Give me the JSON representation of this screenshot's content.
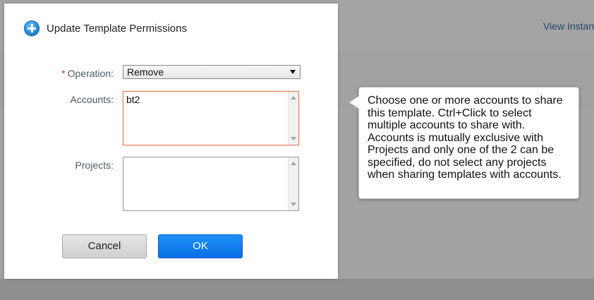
{
  "background": {
    "link_label": "View Instan"
  },
  "dialog": {
    "title": "Update Template Permissions",
    "icon": "plus-circle-icon",
    "operation": {
      "label": "Operation:",
      "required_mark": "*",
      "selected": "Remove"
    },
    "accounts": {
      "label": "Accounts:",
      "items": [
        "bt2"
      ]
    },
    "projects": {
      "label": "Projects:",
      "items": []
    },
    "buttons": {
      "cancel": "Cancel",
      "ok": "OK"
    }
  },
  "tooltip": {
    "text": "Choose one or more accounts to share this template. Ctrl+Click to select multiple accounts to share with. Accounts is mutually exclusive with Projects and only one of the 2 can be specified, do not select any projects when sharing templates with accounts."
  },
  "colors": {
    "ok_button": "#0a6fe3",
    "required_mark": "#c0392b",
    "accounts_border": "#e47a5b",
    "overlay": "#a3a3a3"
  }
}
